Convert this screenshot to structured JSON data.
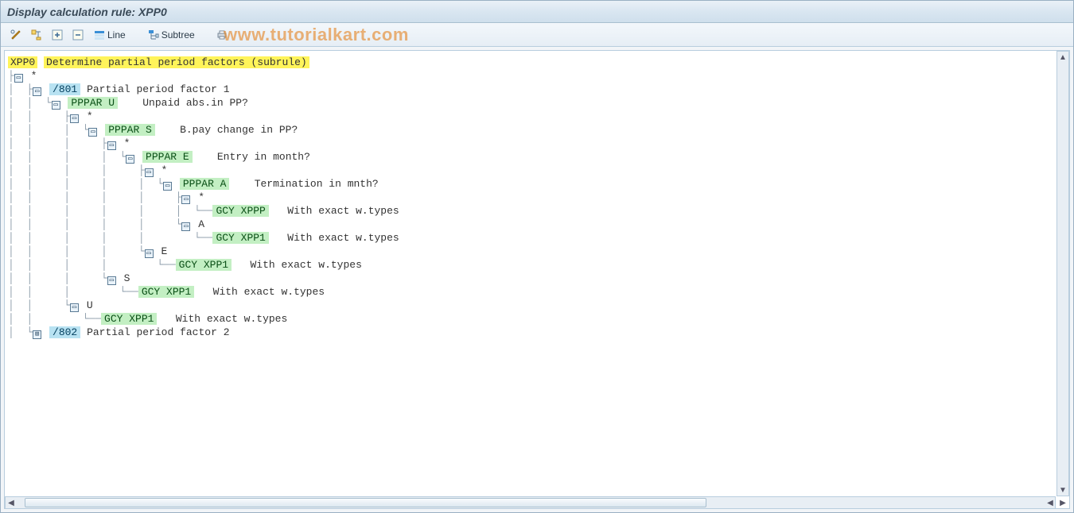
{
  "title": "Display calculation rule: XPP0",
  "toolbar": {
    "line_label": "Line",
    "subtree_label": "Subtree"
  },
  "watermark": "www.tutorialkart.com",
  "tree": {
    "root": {
      "code": "XPP0",
      "desc": "Determine partial period factors (subrule)"
    },
    "l1_star": "*",
    "l2_801": {
      "code": "/801",
      "desc": "Partial period factor 1"
    },
    "l2_ppparU": {
      "code": "PPPAR U",
      "desc": "Unpaid abs.in PP?"
    },
    "l3_star": "*",
    "l3_ppparS": {
      "code": "PPPAR S",
      "desc": "B.pay change in PP?"
    },
    "l4_star": "*",
    "l4_ppparE": {
      "code": "PPPAR E",
      "desc": "Entry in month?"
    },
    "l5_star": "*",
    "l5_ppparA": {
      "code": "PPPAR A",
      "desc": "Termination in mnth?"
    },
    "l6_star": "*",
    "l6_gcyXPPP": {
      "code": "GCY XPPP",
      "desc": "With exact w.types"
    },
    "l6_A": "A",
    "l6_gcyXPP1_a": {
      "code": "GCY XPP1",
      "desc": "With exact w.types"
    },
    "l5_E": "E",
    "l5_gcyXPP1_e": {
      "code": "GCY XPP1",
      "desc": "With exact w.types"
    },
    "l4_S": "S",
    "l4_gcyXPP1_s": {
      "code": "GCY XPP1",
      "desc": "With exact w.types"
    },
    "l3_U": "U",
    "l3_gcyXPP1_u": {
      "code": "GCY XPP1",
      "desc": "With exact w.types"
    },
    "l1_802": {
      "code": "/802",
      "desc": "Partial period factor 2"
    }
  }
}
